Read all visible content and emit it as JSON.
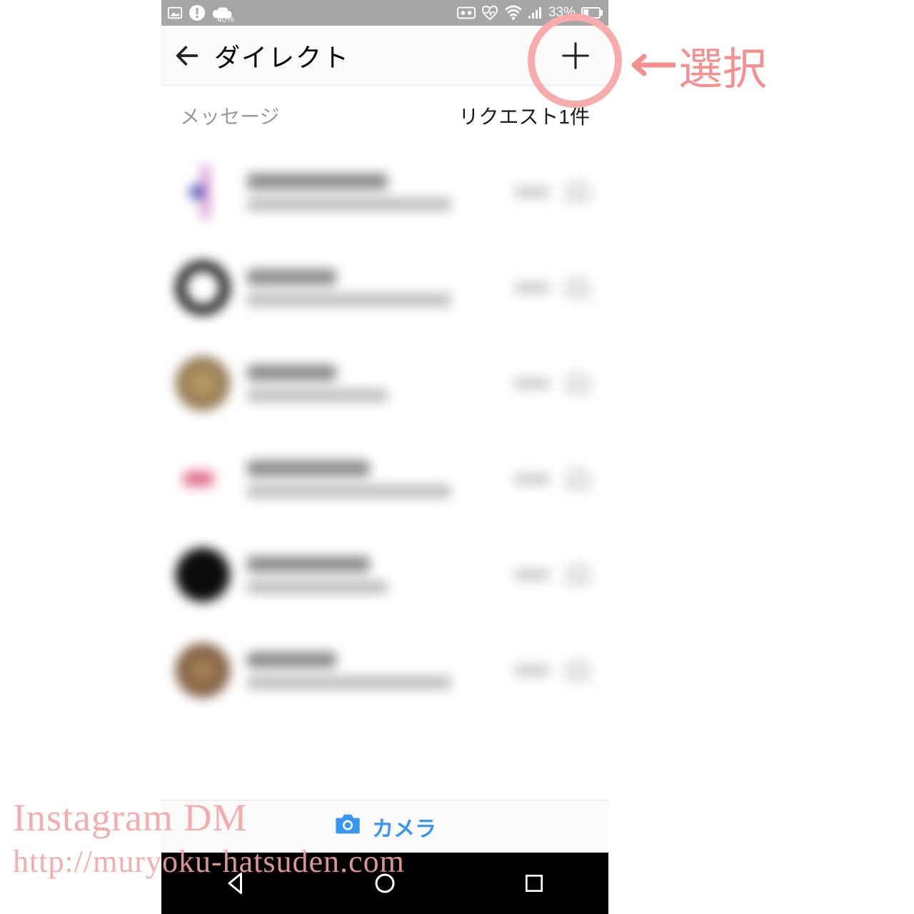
{
  "status_bar": {
    "cloud_percent": "40%",
    "battery_percent": "33%"
  },
  "header": {
    "title": "ダイレクト"
  },
  "sub_header": {
    "messages_label": "メッセージ",
    "requests_label": "リクエスト1件"
  },
  "camera_bar": {
    "label": "カメラ"
  },
  "annotation": {
    "text": "選択"
  },
  "watermark": {
    "line1": "Instagram DM",
    "line2": "http://muryoku-hatsuden.com"
  }
}
